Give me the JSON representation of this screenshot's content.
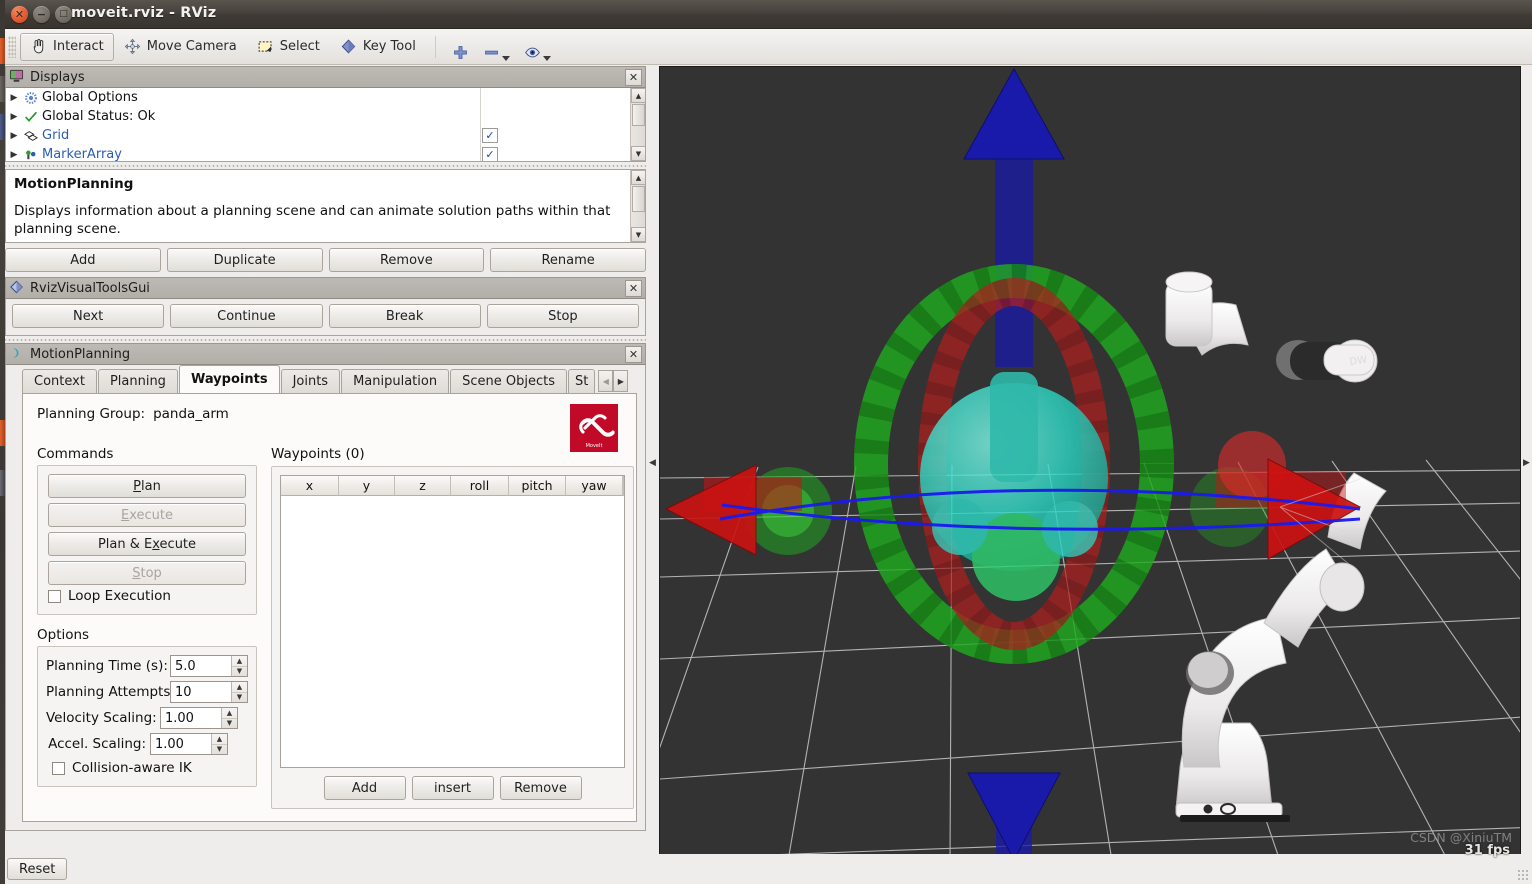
{
  "window": {
    "title": "moveit.rviz - RViz",
    "close_glyph": "✕",
    "minimize_glyph": "−",
    "maximize_glyph": "□"
  },
  "toolbar": {
    "items": [
      {
        "label": "Interact",
        "icon": "hand-cursor-icon",
        "active": true
      },
      {
        "label": "Move Camera",
        "icon": "move-camera-icon",
        "active": false
      },
      {
        "label": "Select",
        "icon": "select-rectangle-icon",
        "active": false
      },
      {
        "label": "Key Tool",
        "icon": "key-tool-diamond-icon",
        "active": false
      }
    ],
    "add_tool_icon": "plus-icon",
    "remove_tool_icon": "minus-icon",
    "visibility_icon": "eye-icon",
    "dropdown_glyph": "▾"
  },
  "displays_panel": {
    "title": "Displays",
    "icon": "displays-monitor-icon",
    "close_glyph": "✕",
    "tree": [
      {
        "label": "Global Options",
        "icon": "gear-icon",
        "checkbox": null,
        "link": false
      },
      {
        "label": "Global Status: Ok",
        "icon": "check-icon",
        "checkbox": null,
        "link": false
      },
      {
        "label": "Grid",
        "icon": "grid-icon",
        "checkbox": "✓",
        "link": true
      },
      {
        "label": "MarkerArray",
        "icon": "marker-array-icon",
        "checkbox": "✓",
        "link": true
      }
    ],
    "description": {
      "title": "MotionPlanning",
      "body": "Displays information about a planning scene and can animate solution paths within that planning scene."
    },
    "buttons": [
      {
        "label": "Add"
      },
      {
        "label": "Duplicate"
      },
      {
        "label": "Remove"
      },
      {
        "label": "Rename"
      }
    ]
  },
  "rviz_visual_tools_panel": {
    "title": "RvizVisualToolsGui",
    "icon": "diamond-icon",
    "close_glyph": "✕",
    "buttons": [
      {
        "label": "Next"
      },
      {
        "label": "Continue"
      },
      {
        "label": "Break"
      },
      {
        "label": "Stop"
      }
    ]
  },
  "motion_planning_panel": {
    "title": "MotionPlanning",
    "icon": "moveit-icon",
    "close_glyph": "✕",
    "tabs": [
      {
        "label": "Context",
        "selected": false
      },
      {
        "label": "Planning",
        "selected": false
      },
      {
        "label": "Waypoints",
        "selected": true
      },
      {
        "label": "Joints",
        "selected": false
      },
      {
        "label": "Manipulation",
        "selected": false
      },
      {
        "label": "Scene Objects",
        "selected": false
      },
      {
        "label": "St",
        "selected": false
      }
    ],
    "tab_scroll_left_glyph": "◀",
    "tab_scroll_right_glyph": "▶",
    "planning_group": {
      "label": "Planning Group:",
      "value": "panda_arm"
    },
    "logo_text": "MoveIt",
    "commands": {
      "title": "Commands",
      "buttons": [
        {
          "label": "Plan",
          "mnemonic_index": 1,
          "disabled": false
        },
        {
          "label": "Execute",
          "mnemonic_index": 0,
          "disabled": true
        },
        {
          "label": "Plan & Execute",
          "mnemonic_index": 8,
          "disabled": false
        },
        {
          "label": "Stop",
          "mnemonic_index": 0,
          "disabled": true
        }
      ],
      "loop_execution": {
        "label": "Loop Execution",
        "checked": false
      }
    },
    "options": {
      "title": "Options",
      "fields": [
        {
          "label": "Planning Time (s):",
          "value": "5.0"
        },
        {
          "label": "Planning Attempts:",
          "value": "10"
        },
        {
          "label": "Velocity Scaling:",
          "value": "1.00"
        },
        {
          "label": "Accel. Scaling:",
          "value": "1.00"
        }
      ],
      "collision_aware_ik": {
        "label": "Collision-aware IK",
        "checked": false
      }
    },
    "waypoints": {
      "title": "Waypoints (0)",
      "columns": [
        "x",
        "y",
        "z",
        "roll",
        "pitch",
        "yaw"
      ],
      "rows": [],
      "buttons": [
        {
          "label": "Add"
        },
        {
          "label": "insert"
        },
        {
          "label": "Remove"
        }
      ]
    }
  },
  "view3d": {
    "background_color": "#333333",
    "grid_color": "#c8c8c8",
    "fps": "31 fps",
    "watermark": "CSDN @XiniuTM",
    "markers": {
      "axis_x_color": "#cc1111",
      "axis_y_color": "#11aa22",
      "axis_z_color": "#1a1aaa",
      "ring_green": "#1faa1f",
      "ring_red": "#b41f1f",
      "sphere_color": "#2fd6c4",
      "robot_color": "#f2f2f2"
    },
    "collapse_left_glyph": "◀",
    "collapse_right_glyph": "▶"
  },
  "statusbar": {
    "reset_label": "Reset"
  }
}
